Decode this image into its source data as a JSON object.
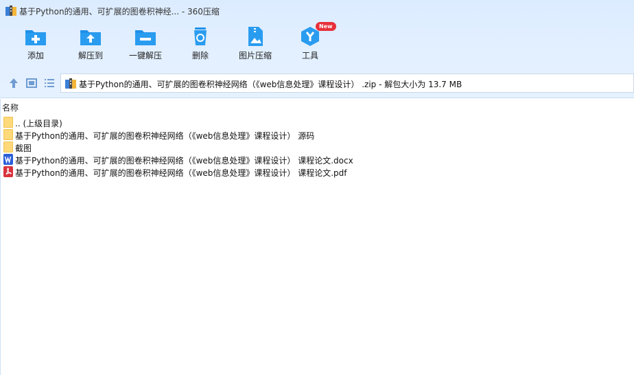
{
  "window": {
    "title": "基于Python的通用、可扩展的图卷积神经... - 360压缩"
  },
  "toolbar": {
    "items": [
      {
        "label": "添加",
        "icon": "add-icon"
      },
      {
        "label": "解压到",
        "icon": "extract-to-icon"
      },
      {
        "label": "一键解压",
        "icon": "one-click-extract-icon"
      },
      {
        "label": "删除",
        "icon": "delete-icon"
      },
      {
        "label": "图片压缩",
        "icon": "image-compress-icon"
      },
      {
        "label": "工具",
        "icon": "tools-icon",
        "badge": "New"
      }
    ],
    "accent_color": "#1e90e8"
  },
  "nav": {
    "address": "基于Python的通用、可扩展的图卷积神经网络（《web信息处理》课程设计） .zip - 解包大小为 13.7 MB"
  },
  "file_list": {
    "column_name": "名称",
    "rows": [
      {
        "name": ".. (上级目录)",
        "type": "folder"
      },
      {
        "name": "基于Python的通用、可扩展的图卷积神经网络（《web信息处理》课程设计） 源码",
        "type": "folder"
      },
      {
        "name": "截图",
        "type": "folder"
      },
      {
        "name": "基于Python的通用、可扩展的图卷积神经网络（《web信息处理》课程设计） 课程论文.docx",
        "type": "docx"
      },
      {
        "name": "基于Python的通用、可扩展的图卷积神经网络（《web信息处理》课程设计） 课程论文.pdf",
        "type": "pdf"
      }
    ]
  }
}
